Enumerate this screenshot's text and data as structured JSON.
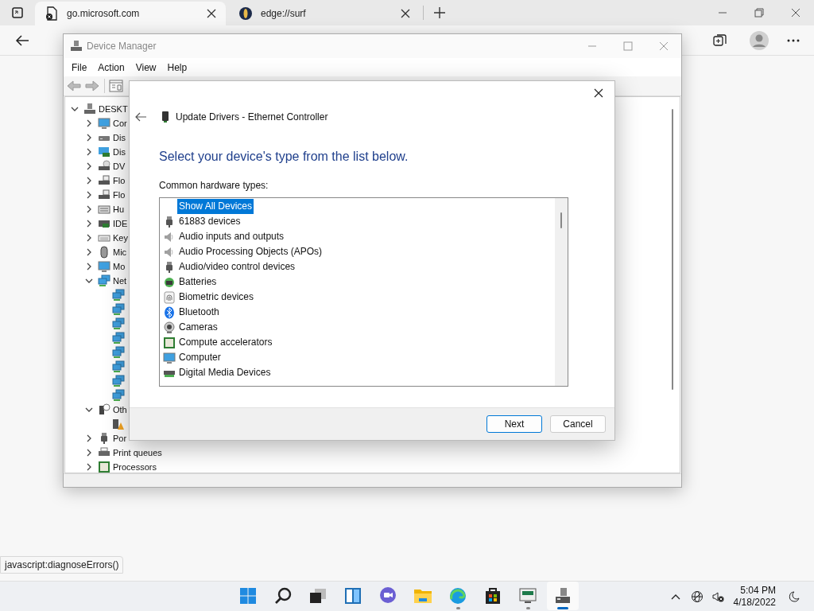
{
  "browser": {
    "tabs": [
      {
        "title": "go.microsoft.com",
        "selected": true
      },
      {
        "title": "edge://surf",
        "selected": false
      }
    ],
    "status_text": "javascript:diagnoseErrors()"
  },
  "device_manager": {
    "title": "Device Manager",
    "menu": [
      "File",
      "Action",
      "View",
      "Help"
    ],
    "tree": {
      "label": "DESKT",
      "expanded": true,
      "children": [
        {
          "label": "Cor",
          "kind": "computer",
          "expanded": false
        },
        {
          "label": "Dis",
          "kind": "disk",
          "expanded": false
        },
        {
          "label": "Dis",
          "kind": "display",
          "expanded": false
        },
        {
          "label": "DV",
          "kind": "dvd",
          "expanded": false
        },
        {
          "label": "Flo",
          "kind": "floppy",
          "expanded": false
        },
        {
          "label": "Flo",
          "kind": "floppy",
          "expanded": false
        },
        {
          "label": "Hu",
          "kind": "hid",
          "expanded": false
        },
        {
          "label": "IDE",
          "kind": "ide",
          "expanded": false
        },
        {
          "label": "Key",
          "kind": "keyboard",
          "expanded": false
        },
        {
          "label": "Mic",
          "kind": "mouse",
          "expanded": false
        },
        {
          "label": "Mo",
          "kind": "computer",
          "expanded": false
        },
        {
          "label": "Net",
          "kind": "network",
          "expanded": true,
          "children": [
            {
              "kind": "network"
            },
            {
              "kind": "network"
            },
            {
              "kind": "network"
            },
            {
              "kind": "network"
            },
            {
              "kind": "network"
            },
            {
              "kind": "network"
            },
            {
              "kind": "network"
            },
            {
              "kind": "network"
            }
          ]
        },
        {
          "label": "Oth",
          "kind": "other",
          "expanded": true,
          "children": [
            {
              "kind": "warning"
            }
          ]
        },
        {
          "label": "Por",
          "kind": "plug",
          "expanded": false
        },
        {
          "label": "Print queues",
          "kind": "printer",
          "expanded": false
        },
        {
          "label": "Processors",
          "kind": "chip",
          "expanded": false
        }
      ]
    }
  },
  "dialog": {
    "title": "Update Drivers - Ethernet Controller",
    "heading": "Select your device's type from the list below.",
    "list_label": "Common hardware types:",
    "items": [
      {
        "label": "Show All Devices",
        "kind": "none",
        "selected": true
      },
      {
        "label": "61883 devices",
        "kind": "plug",
        "selected": false
      },
      {
        "label": "Audio inputs and outputs",
        "kind": "speaker",
        "selected": false
      },
      {
        "label": "Audio Processing Objects (APOs)",
        "kind": "speaker",
        "selected": false
      },
      {
        "label": "Audio/video control devices",
        "kind": "plug",
        "selected": false
      },
      {
        "label": "Batteries",
        "kind": "battery",
        "selected": false
      },
      {
        "label": "Biometric devices",
        "kind": "fingerprint",
        "selected": false
      },
      {
        "label": "Bluetooth",
        "kind": "bluetooth",
        "selected": false
      },
      {
        "label": "Cameras",
        "kind": "camera",
        "selected": false
      },
      {
        "label": "Compute accelerators",
        "kind": "chip",
        "selected": false
      },
      {
        "label": "Computer",
        "kind": "computer",
        "selected": false
      },
      {
        "label": "Digital Media Devices",
        "kind": "media",
        "selected": false
      }
    ],
    "buttons": [
      {
        "label": "Next",
        "default": true
      },
      {
        "label": "Cancel",
        "default": false
      }
    ]
  },
  "taskbar": {
    "apps": [
      {
        "kind": "start",
        "running": false,
        "active": false
      },
      {
        "kind": "search",
        "running": false,
        "active": false
      },
      {
        "kind": "taskview",
        "running": false,
        "active": false
      },
      {
        "kind": "widgets",
        "running": false,
        "active": false
      },
      {
        "kind": "chat",
        "running": false,
        "active": false
      },
      {
        "kind": "folder",
        "running": false,
        "active": false
      },
      {
        "kind": "edge",
        "running": true,
        "active": false
      },
      {
        "kind": "store",
        "running": false,
        "active": false
      },
      {
        "kind": "monitor",
        "running": true,
        "active": false
      },
      {
        "kind": "devmgr",
        "running": true,
        "active": true
      }
    ],
    "time": "5:04 PM",
    "date": "4/18/2022"
  }
}
